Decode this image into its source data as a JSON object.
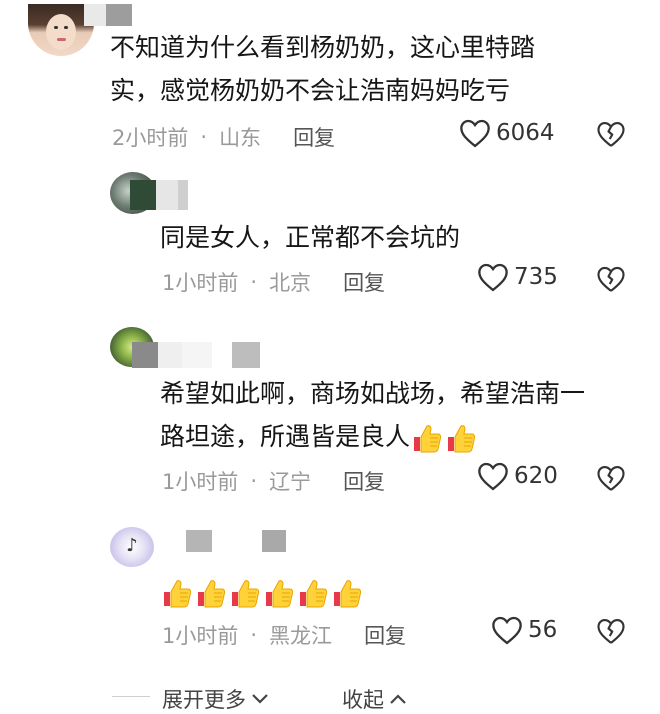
{
  "comments": [
    {
      "text_line1": "不知道为什么看到杨奶奶，这心里特踏",
      "text_line2": "实，感觉杨奶奶不会让浩南妈妈吃亏",
      "time": "2小时前",
      "location": "山东",
      "reply_label": "回复",
      "likes": "6064"
    },
    {
      "text_line1": "同是女人，正常都不会坑的",
      "time": "1小时前",
      "location": "北京",
      "reply_label": "回复",
      "likes": "735"
    },
    {
      "text_line1": "希望如此啊，商场如战场，希望浩南一",
      "text_line2": "路坦途，所遇皆是良人",
      "emoji_count": 2,
      "time": "1小时前",
      "location": "辽宁",
      "reply_label": "回复",
      "likes": "620"
    },
    {
      "emoji_count": 6,
      "time": "1小时前",
      "location": "黑龙江",
      "reply_label": "回复",
      "likes": "56"
    }
  ],
  "footer": {
    "expand_label": "展开更多",
    "collapse_label": "收起"
  },
  "separator": "·",
  "icons": {
    "like": "heart-outline-icon",
    "dislike": "broken-heart-icon",
    "emoji": "thumbs-up-emoji"
  }
}
